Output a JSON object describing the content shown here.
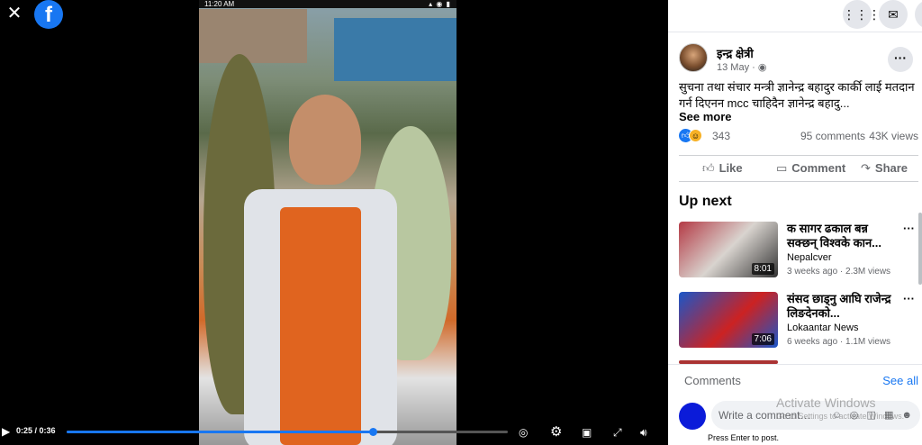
{
  "player": {
    "status_time": "11:20 AM",
    "status_icons": "▴ ◉ ▮",
    "time_display": "0:25 / 0:36",
    "progress_fraction": 0.694
  },
  "topbar": {
    "menu_icon": "grid-icon",
    "messenger_icon": "messenger-icon"
  },
  "post": {
    "author": "इन्द्र क्षेत्री",
    "date": "13 May · ",
    "globe": "◉",
    "text": "सुचना तथा संचार मन्त्री ज्ञानेन्द्र बहादुर कार्की लाई मतदान गर्न दिएनन mcc चाहिदैन ज्ञानेन्द्र बहादु...",
    "see_more": "See more",
    "reactions": "343",
    "comments": "95 comments",
    "views": "43K views",
    "like_label": "Like",
    "comment_label": "Comment",
    "share_label": "Share"
  },
  "upnext": {
    "title": "Up next",
    "items": [
      {
        "title": "क सागर ढकाल बन्न सक्छन् विश्वके कान...",
        "channel": "Nepalcver",
        "meta": "3 weeks ago · 2.3M views",
        "duration": "8:01",
        "color": "#b43a45"
      },
      {
        "title": "संसद छाड्नु आघि राजेन्द्र लिङदेनको...",
        "channel": "Lokaantar News",
        "meta": "6 weeks ago · 1.1M views",
        "duration": "7:06",
        "color": "#1a56c9"
      }
    ]
  },
  "comments": {
    "label": "Comments",
    "see_all": "See all",
    "placeholder": "Write a comment…",
    "press_enter": "Press Enter to post.",
    "watermark_title": "Activate Windows",
    "watermark_sub": "Go to Settings to activate Windows."
  }
}
